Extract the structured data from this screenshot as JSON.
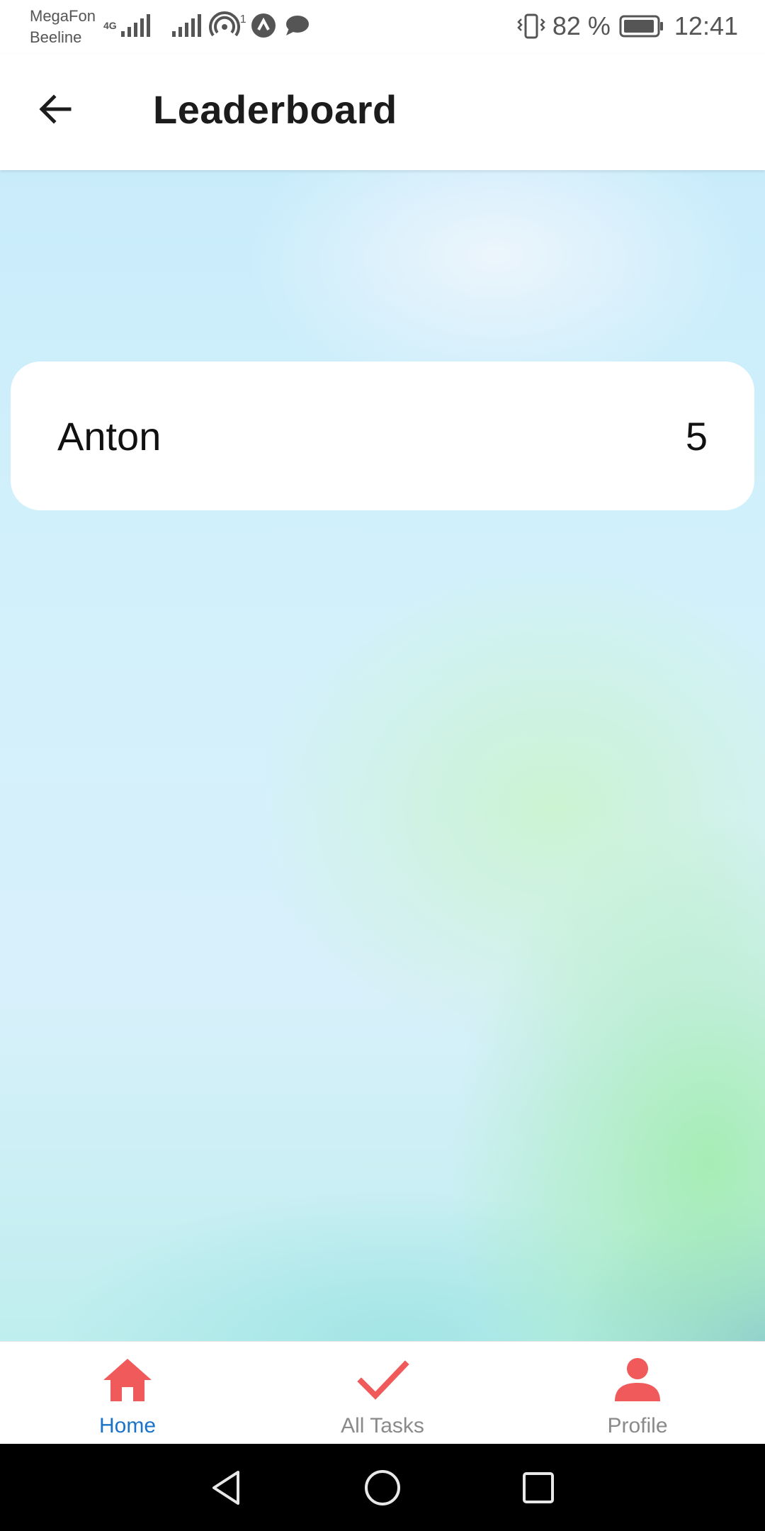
{
  "status_bar": {
    "carrier_1": "MegaFon",
    "carrier_2": "Beeline",
    "network_type": "4G",
    "hotspot_count": "1",
    "battery_percent": "82 %",
    "time": "12:41",
    "icons": [
      "signal-icon",
      "signal-icon",
      "hotspot-icon",
      "app-notification-icon",
      "message-icon",
      "vibrate-icon",
      "battery-icon"
    ]
  },
  "app_bar": {
    "title": "Leaderboard",
    "back_icon": "arrow-left-icon"
  },
  "leaderboard": {
    "rows": [
      {
        "name": "Anton",
        "score": "5"
      }
    ]
  },
  "bottom_nav": {
    "items": [
      {
        "label": "Home",
        "icon": "home-icon",
        "active": true
      },
      {
        "label": "All Tasks",
        "icon": "check-icon",
        "active": false
      },
      {
        "label": "Profile",
        "icon": "person-icon",
        "active": false
      }
    ],
    "icon_color": "#f05a5a",
    "active_label_color": "#1a73c8",
    "inactive_label_color": "#8a8a8a"
  },
  "system_nav": {
    "icons": [
      "back-triangle-icon",
      "home-circle-icon",
      "recents-square-icon"
    ]
  }
}
